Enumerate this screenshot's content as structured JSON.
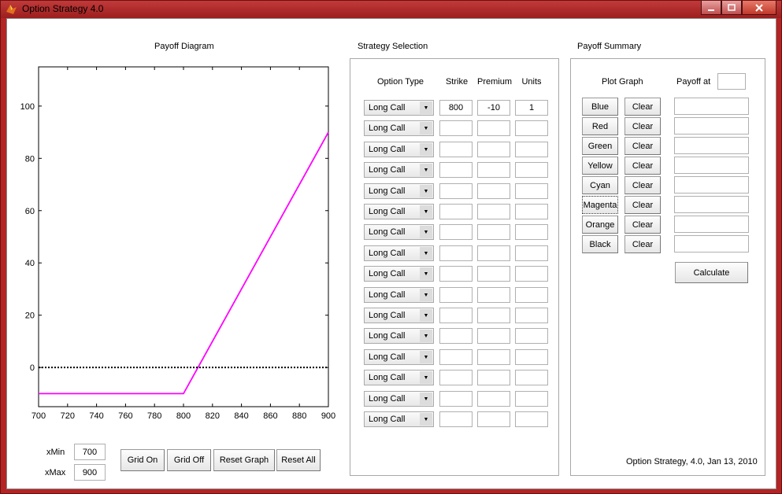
{
  "window": {
    "title": "Option Strategy 4.0",
    "min_icon": "minimize-icon",
    "max_icon": "maximize-icon",
    "close_icon": "close-icon",
    "app_icon": "matlab-icon"
  },
  "payoff_diagram": {
    "title": "Payoff Diagram",
    "xmin_label": "xMin",
    "xmin_value": "700",
    "xmax_label": "xMax",
    "xmax_value": "900",
    "buttons": [
      "Grid On",
      "Grid Off",
      "Reset Graph",
      "Reset All"
    ]
  },
  "chart_data": {
    "type": "line",
    "title": "",
    "xlabel": "",
    "ylabel": "",
    "xlim": [
      700,
      900
    ],
    "ylim": [
      -15,
      115
    ],
    "xticks": [
      700,
      720,
      740,
      760,
      780,
      800,
      820,
      840,
      860,
      880,
      900
    ],
    "yticks": [
      0,
      20,
      40,
      60,
      80,
      100
    ],
    "grid": false,
    "series": [
      {
        "color": "#ff00ff",
        "style": "solid",
        "x": [
          700,
          800,
          900
        ],
        "y": [
          -10,
          -10,
          90
        ]
      },
      {
        "color": "#000000",
        "style": "dotted",
        "x": [
          700,
          900
        ],
        "y": [
          0,
          0
        ]
      }
    ]
  },
  "strategy_selection": {
    "title": "Strategy Selection",
    "headers": {
      "option_type": "Option Type",
      "strike": "Strike",
      "premium": "Premium",
      "units": "Units"
    },
    "rows": [
      {
        "option_type": "Long Call",
        "strike": "800",
        "premium": "-10",
        "units": "1"
      },
      {
        "option_type": "Long Call",
        "strike": "",
        "premium": "",
        "units": ""
      },
      {
        "option_type": "Long Call",
        "strike": "",
        "premium": "",
        "units": ""
      },
      {
        "option_type": "Long Call",
        "strike": "",
        "premium": "",
        "units": ""
      },
      {
        "option_type": "Long Call",
        "strike": "",
        "premium": "",
        "units": ""
      },
      {
        "option_type": "Long Call",
        "strike": "",
        "premium": "",
        "units": ""
      },
      {
        "option_type": "Long Call",
        "strike": "",
        "premium": "",
        "units": ""
      },
      {
        "option_type": "Long Call",
        "strike": "",
        "premium": "",
        "units": ""
      },
      {
        "option_type": "Long Call",
        "strike": "",
        "premium": "",
        "units": ""
      },
      {
        "option_type": "Long Call",
        "strike": "",
        "premium": "",
        "units": ""
      },
      {
        "option_type": "Long Call",
        "strike": "",
        "premium": "",
        "units": ""
      },
      {
        "option_type": "Long Call",
        "strike": "",
        "premium": "",
        "units": ""
      },
      {
        "option_type": "Long Call",
        "strike": "",
        "premium": "",
        "units": ""
      },
      {
        "option_type": "Long Call",
        "strike": "",
        "premium": "",
        "units": ""
      },
      {
        "option_type": "Long Call",
        "strike": "",
        "premium": "",
        "units": ""
      },
      {
        "option_type": "Long Call",
        "strike": "",
        "premium": "",
        "units": ""
      }
    ]
  },
  "payoff_summary": {
    "title": "Payoff Summary",
    "plot_graph_label": "Plot Graph",
    "payoff_at_label": "Payoff at",
    "payoff_at_value": "",
    "colors": [
      "Blue",
      "Red",
      "Green",
      "Yellow",
      "Cyan",
      "Magenta",
      "Orange",
      "Black"
    ],
    "clear_label": "Clear",
    "calculate_label": "Calculate",
    "footer": "Option Strategy, 4.0, Jan 13, 2010"
  }
}
